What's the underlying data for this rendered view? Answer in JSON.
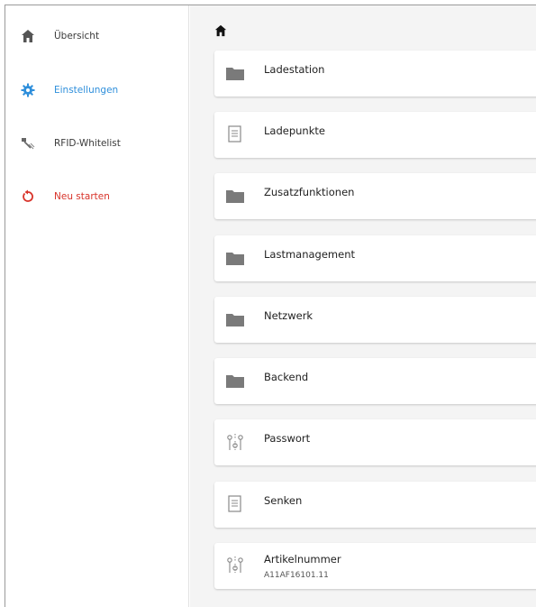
{
  "sidebar": {
    "items": [
      {
        "label": "Übersicht",
        "icon": "home-icon",
        "state": "normal"
      },
      {
        "label": "Einstellungen",
        "icon": "gear-icon",
        "state": "active"
      },
      {
        "label": "RFID-Whitelist",
        "icon": "rfid-tag-icon",
        "state": "normal"
      },
      {
        "label": "Neu starten",
        "icon": "restart-icon",
        "state": "danger"
      }
    ]
  },
  "breadcrumb": {
    "icon": "home-icon"
  },
  "settings": {
    "items": [
      {
        "title": "Ladestation",
        "icon": "folder-icon"
      },
      {
        "title": "Ladepunkte",
        "icon": "document-icon"
      },
      {
        "title": "Zusatzfunktionen",
        "icon": "folder-icon"
      },
      {
        "title": "Lastmanagement",
        "icon": "folder-icon"
      },
      {
        "title": "Netzwerk",
        "icon": "folder-icon"
      },
      {
        "title": "Backend",
        "icon": "folder-icon"
      },
      {
        "title": "Passwort",
        "icon": "sliders-icon"
      },
      {
        "title": "Senken",
        "icon": "document-icon"
      },
      {
        "title": "Artikelnummer",
        "subtitle": "A11AF16101.11",
        "icon": "sliders-icon"
      }
    ]
  },
  "colors": {
    "accent": "#2f8fdb",
    "danger": "#d8332a",
    "icon_gray": "#7a7a7a",
    "background": "#f4f4f4"
  }
}
